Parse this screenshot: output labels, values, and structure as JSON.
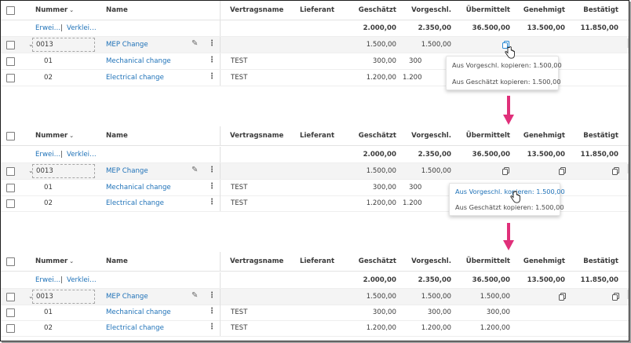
{
  "columns": {
    "nummer": "Nummer",
    "name": "Name",
    "vertragsname": "Vertragsname",
    "lieferant": "Lieferant",
    "geschaetzt": "Geschätzt",
    "vorgeschl": "Vorgeschl.",
    "uebermittelt": "Übermittelt",
    "genehmigt": "Genehmigt",
    "bestaetigt": "Bestätigt"
  },
  "sums_row": {
    "expand_link": "Erwei…",
    "separator": "|",
    "collapse_link": "Verklei…",
    "geschaetzt": "2.000,00",
    "vorgeschl": "2.350,00",
    "uebermittelt": "36.500,00",
    "genehmigt": "13.500,00",
    "bestaetigt": "11.850,00"
  },
  "group_row": {
    "nummer": "0013",
    "name": "MEP Change",
    "geschaetzt": "1.500,00",
    "vorgeschl": "1.500,00",
    "uebermittelt_after": "1.500,00"
  },
  "child_rows": [
    {
      "nummer": "01",
      "name": "Mechanical change",
      "vertragsname": "TEST",
      "geschaetzt": "300,00",
      "vorgeschl": "300,00",
      "vorgeschl_partial": "300",
      "uebermittelt": "300,00"
    },
    {
      "nummer": "02",
      "name": "Electrical change",
      "vertragsname": "TEST",
      "geschaetzt": "1.200,00",
      "vorgeschl": "1.200,00",
      "vorgeschl_partial": "1.200",
      "uebermittelt": "1.200,00"
    }
  ],
  "copy_menu": {
    "from_vorgeschl": "Aus Vorgeschl. kopieren: 1.500,00",
    "from_geschaetzt": "Aus Geschätzt kopieren: 1.500,00"
  },
  "colors": {
    "link": "#1f72b8",
    "arrow": "#e0307a",
    "group_bg": "#f4f4f4"
  },
  "icons": [
    "chevron-down-icon",
    "pencil-icon",
    "kebab-menu-icon",
    "copy-icon",
    "hand-pointer-icon",
    "arrow-down-icon",
    "checkbox-icon"
  ]
}
